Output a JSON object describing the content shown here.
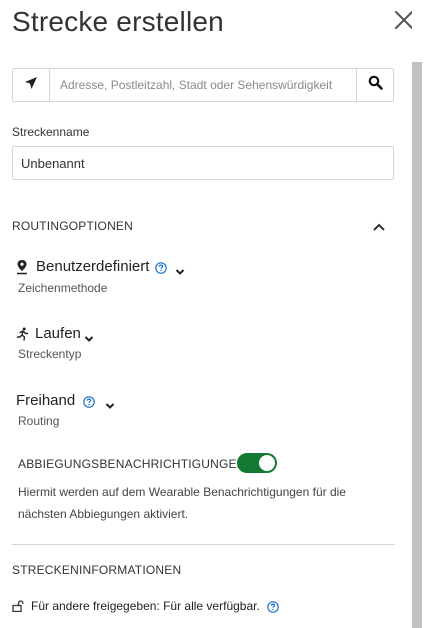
{
  "header": {
    "title": "Strecke erstellen"
  },
  "search": {
    "placeholder": "Adresse, Postleitzahl, Stadt oder Sehenswürdigkeit"
  },
  "route_name": {
    "label": "Streckenname",
    "value": "Unbenannt"
  },
  "routing_options": {
    "heading": "ROUTINGOPTIONEN",
    "drawing_method": {
      "value": "Benutzerdefiniert",
      "caption": "Zeichenmethode"
    },
    "route_type": {
      "value": "Laufen",
      "caption": "Streckentyp"
    },
    "routing": {
      "value": "Freihand",
      "caption": "Routing"
    },
    "turn_notifications": {
      "label": "ABBIEGUNGSBENACHRICHTIGUNGEN",
      "enabled": true,
      "description": "Hiermit werden auf dem Wearable Benachrichtigungen für die nächsten Abbiegungen aktiviert."
    }
  },
  "route_info": {
    "heading": "STRECKENINFORMATIONEN",
    "sharing": "Für andere freigegeben: Für alle verfügbar."
  },
  "colors": {
    "accent_toggle": "#127a32",
    "text": "#333333",
    "help_icon": "#1a73c9",
    "border": "#d6d6d6"
  }
}
